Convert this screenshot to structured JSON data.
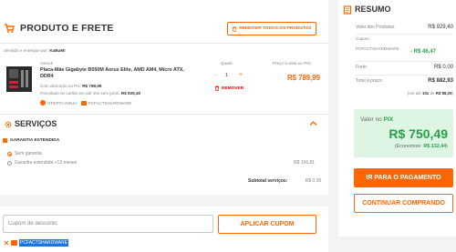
{
  "cart": {
    "title": "PRODUTO E FRETE",
    "remove_all_label": "REMOVER TODOS OS PRODUTOS",
    "seller_prefix": "Vendido e entregue por:",
    "seller_name": "KaBuM!",
    "item": {
      "brand": "Asrock",
      "name": "Placa-Mãe Gigabyte B550M Aorus Elite, AMD AM4, Micro ATX, DDR4",
      "discount_text": "Com desconto no Pix:",
      "discount_value": "R$ 789,99",
      "installment_text": "Parcelado no cartão em até 10x sem juros:",
      "installment_value": "R$ 929,40",
      "qty_label": "Quant.",
      "qty_minus": "−",
      "qty_value": "1",
      "qty_plus": "+",
      "remove_label": "REMOVER",
      "price_label": "Preço à vista no PIX:",
      "price_value": "R$ 789,99",
      "badge_ninja": "OFERTA NINJA",
      "badge_coupon": "PCFACTSHARDWARE"
    }
  },
  "services": {
    "title": "SERVIÇOS",
    "warranty_title": "GARANTIA ESTENDIDA",
    "option_none": "Sem garantia",
    "option_extended": "Garantia estendida +12 meses",
    "option_extended_price": "R$ 156,81",
    "subtotal_label": "Subtotal serviços:",
    "subtotal_value": "R$ 0,00"
  },
  "coupon": {
    "placeholder": "Cupom de desconto",
    "apply_label": "APLICAR CUPOM",
    "applied_code": "PCFACTSHARDWARE"
  },
  "summary": {
    "title": "RESUMO",
    "products_label": "Valor dos Produtos:",
    "products_value": "R$ 929,40",
    "coupon_label": "Cupom",
    "coupon_code": "PCFACTSHARDWARE",
    "coupon_discount": "- R$ 46,47",
    "shipping_label": "Frete:",
    "shipping_value": "R$ 0,00",
    "total_installment_label": "Total à prazo:",
    "total_installment_value": "R$ 882,93",
    "installment_prefix": "(em até",
    "installment_count": "10x",
    "installment_middle": "de",
    "installment_value": "R$ 88,29",
    "installment_suffix": ")",
    "pix_label_prefix": "Valor no",
    "pix_label_strong": "PIX",
    "pix_value": "R$ 750,49",
    "pix_savings_prefix": "(Economize:",
    "pix_savings_value": "R$ 132,44",
    "pix_savings_suffix": ")",
    "pay_button": "IR PARA O PAGAMENTO",
    "continue_button": "CONTINUAR COMPRANDO"
  },
  "colors": {
    "accent": "#ff6500",
    "success": "#24a148",
    "danger": "#ff0000"
  }
}
